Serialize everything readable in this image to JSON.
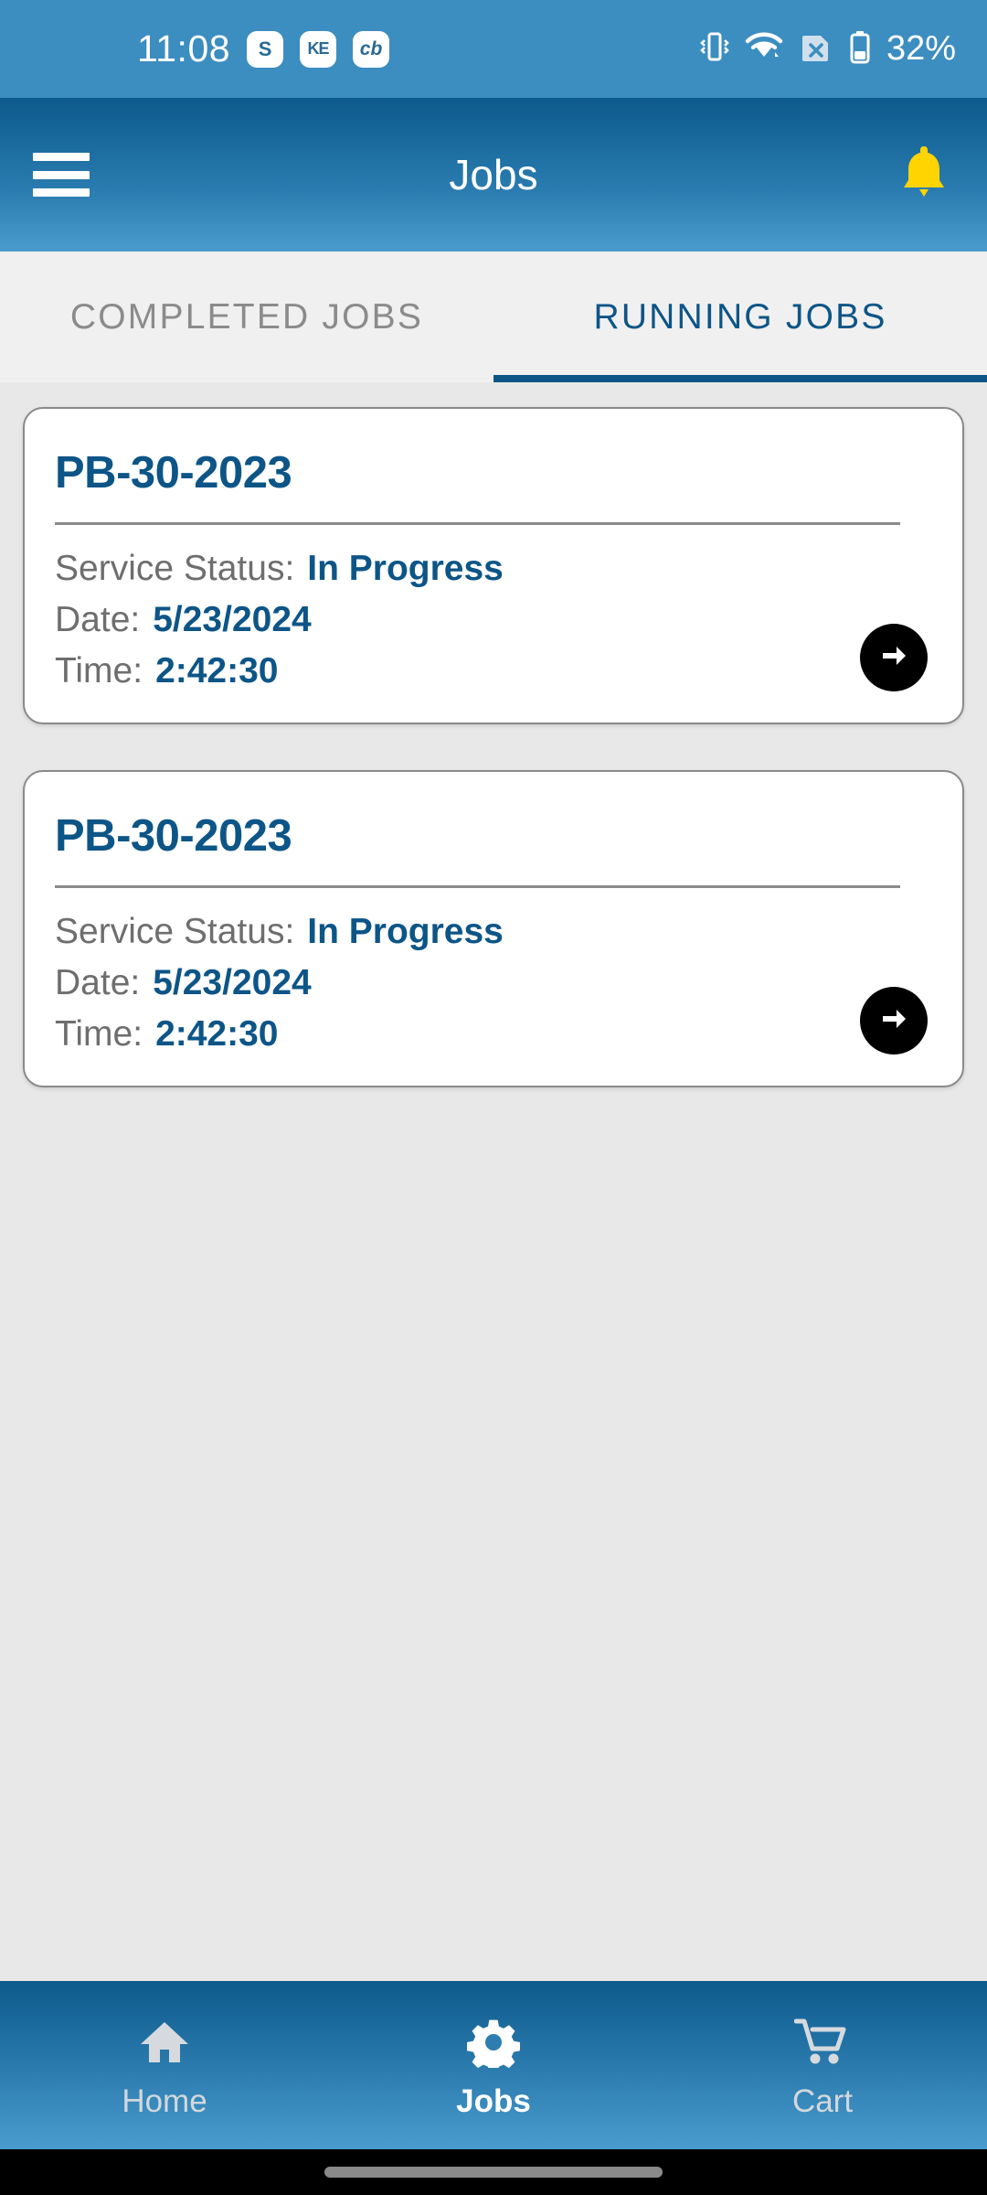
{
  "status_bar": {
    "time": "11:08",
    "app_icons": [
      {
        "name": "skype-icon",
        "glyph": "S"
      },
      {
        "name": "ke-app-icon",
        "glyph": "KE"
      },
      {
        "name": "cb-app-icon",
        "glyph": "cb"
      }
    ],
    "icons": [
      {
        "name": "vibrate-icon"
      },
      {
        "name": "wifi-icon"
      },
      {
        "name": "sim-error-icon"
      },
      {
        "name": "battery-icon"
      }
    ],
    "battery_percent": "32%"
  },
  "app_bar": {
    "menu_icon": "hamburger-menu-icon",
    "title": "Jobs",
    "notification_icon": "bell-icon",
    "bell_color": "#ffd400"
  },
  "tabs": [
    {
      "label": "COMPLETED JOBS",
      "active": false
    },
    {
      "label": "RUNNING JOBS",
      "active": true
    }
  ],
  "jobs": [
    {
      "title": "PB-30-2023",
      "status_label": "Service Status:",
      "status_value": "In Progress",
      "date_label": "Date:",
      "date_value": "5/23/2024",
      "time_label": "Time:",
      "time_value": "2:42:30",
      "action_icon": "arrow-right-icon"
    },
    {
      "title": "PB-30-2023",
      "status_label": "Service Status:",
      "status_value": "In Progress",
      "date_label": "Date:",
      "date_value": "5/23/2024",
      "time_label": "Time:",
      "time_value": "2:42:30",
      "action_icon": "arrow-right-icon"
    }
  ],
  "bottom_nav": [
    {
      "label": "Home",
      "icon": "home-icon",
      "active": false
    },
    {
      "label": "Jobs",
      "icon": "gear-icon",
      "active": true
    },
    {
      "label": "Cart",
      "icon": "shopping-cart-icon",
      "active": false
    }
  ],
  "colors": {
    "accent_blue": "#0d5587",
    "app_bar_top": "#0d5a8c",
    "app_bar_bottom": "#4a9bce",
    "status_bar": "#3c8dc0",
    "page_background": "#e8e8e8",
    "bell_yellow": "#ffd400"
  }
}
